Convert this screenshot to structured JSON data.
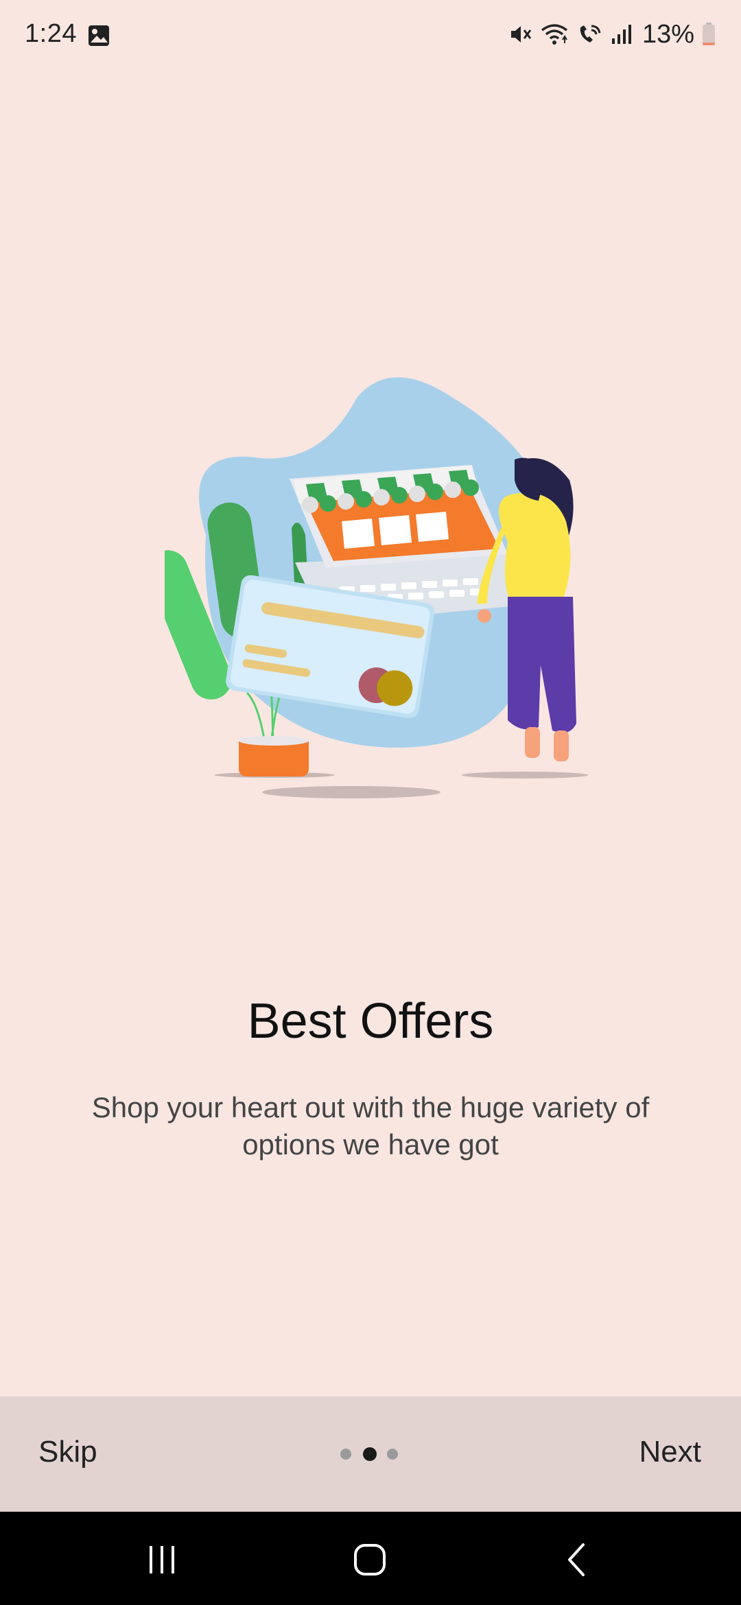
{
  "status_bar": {
    "time": "1:24",
    "battery_percent": "13%",
    "icons": [
      "gallery-icon",
      "mute-icon",
      "wifi-icon",
      "wifi-call-icon",
      "signal-icon",
      "battery-icon"
    ],
    "battery_level": 0.13,
    "battery_color": "#f08a6e"
  },
  "onboarding": {
    "title": "Best Offers",
    "description": "Shop your heart out with the huge variety of options we have got",
    "current_page": 2,
    "total_pages": 3
  },
  "bottom_bar": {
    "skip_label": "Skip",
    "next_label": "Next"
  },
  "nav_bar": {
    "icons": [
      "recent-apps-icon",
      "home-icon",
      "back-icon"
    ]
  },
  "colors": {
    "background": "#f9e6e1",
    "bottom_bar": "#e2d3d1",
    "active_dot": "#1a1a1a",
    "inactive_dot": "#9a9a9a",
    "illustration_blob": "#a8d0ea",
    "illustration_orange": "#f47a2c",
    "illustration_green": "#3aa656",
    "illustration_yellow": "#fbe54a",
    "illustration_purple": "#5b3ca8"
  }
}
